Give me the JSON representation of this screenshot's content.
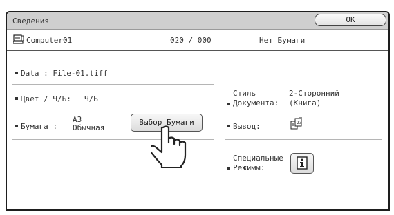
{
  "header": {
    "title": "Сведения",
    "ok_label": "OK"
  },
  "info_bar": {
    "computer_name": "Computer01",
    "counter": "020 / 000",
    "status": "Нет Бумаги"
  },
  "left": {
    "data_label": "Data : File-01.tiff",
    "color_label": "Цвет / Ч/Б:",
    "color_value": "Ч/Б",
    "paper_label": "Бумага :",
    "paper_size": "A3",
    "paper_type": "Обычная",
    "paper_button": "Выбор Бумаги"
  },
  "right": {
    "style_label_1": "Стиль",
    "style_label_2": "Документа:",
    "style_value_1": "2-Сторонний",
    "style_value_2": "(Книга)",
    "output_label": "Вывод:",
    "special_label_1": "Специальные",
    "special_label_2": "Режимы:"
  },
  "icons": {
    "computer": "computer-icon",
    "output": "output-tray-icon",
    "info": "info-icon",
    "pointer": "hand-pointer-icon"
  }
}
